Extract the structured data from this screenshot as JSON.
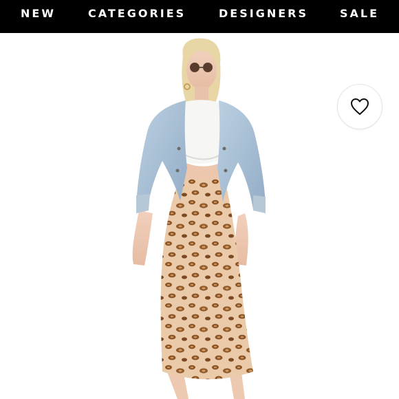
{
  "nav": {
    "items": [
      {
        "label": "NEW"
      },
      {
        "label": "CATEGORIES"
      },
      {
        "label": "DESIGNERS"
      },
      {
        "label": "SALE"
      }
    ]
  },
  "product": {
    "image_icon": "product-photo",
    "favorite_icon": "heart-outline-icon"
  },
  "colors": {
    "nav_bg": "#000000",
    "nav_text": "#ffffff",
    "denim": "#a9bfd4",
    "skirt_base": "#e8c7a8",
    "spots": "#8b5a2b"
  }
}
